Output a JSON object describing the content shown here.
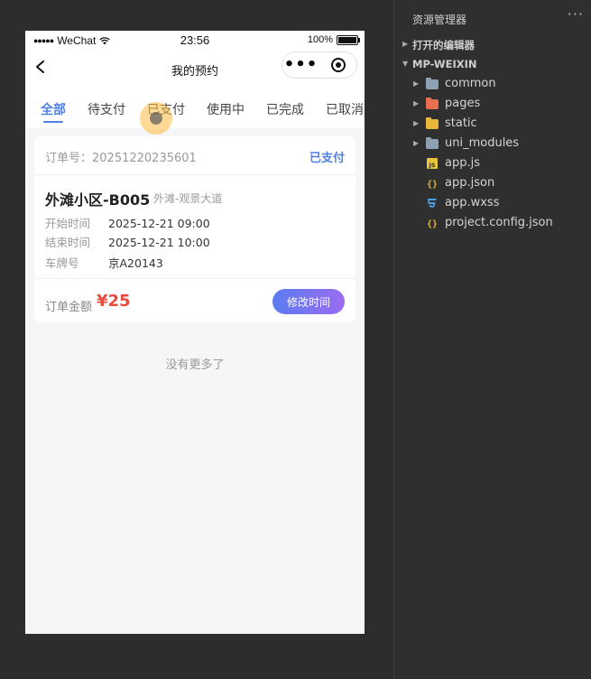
{
  "phone": {
    "status_bar": {
      "signal": "●●●●●",
      "carrier": "WeChat",
      "time": "23:56",
      "battery": "100%"
    },
    "nav": {
      "title": "我的预约",
      "more": "•••"
    },
    "tabs": [
      {
        "label": "全部",
        "active": true
      },
      {
        "label": "待支付",
        "active": false
      },
      {
        "label": "已支付",
        "active": false
      },
      {
        "label": "使用中",
        "active": false
      },
      {
        "label": "已完成",
        "active": false
      },
      {
        "label": "已取消",
        "active": false
      }
    ],
    "order": {
      "number_label": "订单号：20251220235601",
      "status": "已支付",
      "lot_name": "外滩小区-B005",
      "lot_address": "外滩-观景大道",
      "fields": [
        {
          "key": "开始时间",
          "value": "2025-12-21 09:00"
        },
        {
          "key": "结束时间",
          "value": "2025-12-21 10:00"
        },
        {
          "key": "车牌号",
          "value": "京A20143"
        }
      ],
      "amount_label": "订单金额",
      "amount": "¥25",
      "modify_button": "修改时间"
    },
    "no_more": "没有更多了"
  },
  "explorer": {
    "title": "资源管理器",
    "more": "···",
    "open_editors": "打开的编辑器",
    "project": "MP-WEIXIN",
    "items": [
      {
        "name": "common",
        "type": "folder",
        "icon": "folder-icon",
        "color": "#8ea1b3"
      },
      {
        "name": "pages",
        "type": "folder",
        "icon": "pages-folder-icon",
        "color": "#e8704e"
      },
      {
        "name": "static",
        "type": "folder",
        "icon": "static-folder-icon",
        "color": "#e8b63a"
      },
      {
        "name": "uni_modules",
        "type": "folder",
        "icon": "folder-icon",
        "color": "#8ea1b3"
      },
      {
        "name": "app.js",
        "type": "file",
        "icon": "js-file-icon",
        "color": "#e8c53a"
      },
      {
        "name": "app.json",
        "type": "file",
        "icon": "json-file-icon",
        "color": "#e8b63a"
      },
      {
        "name": "app.wxss",
        "type": "file",
        "icon": "css-file-icon",
        "color": "#4aa0e6"
      },
      {
        "name": "project.config.json",
        "type": "file",
        "icon": "json-file-icon",
        "color": "#e8b63a"
      }
    ]
  },
  "colors": {
    "accent": "#4f7fe3",
    "price": "#e84a3c",
    "button_gradient_start": "#5b7cf0",
    "button_gradient_end": "#9b6cf2"
  }
}
